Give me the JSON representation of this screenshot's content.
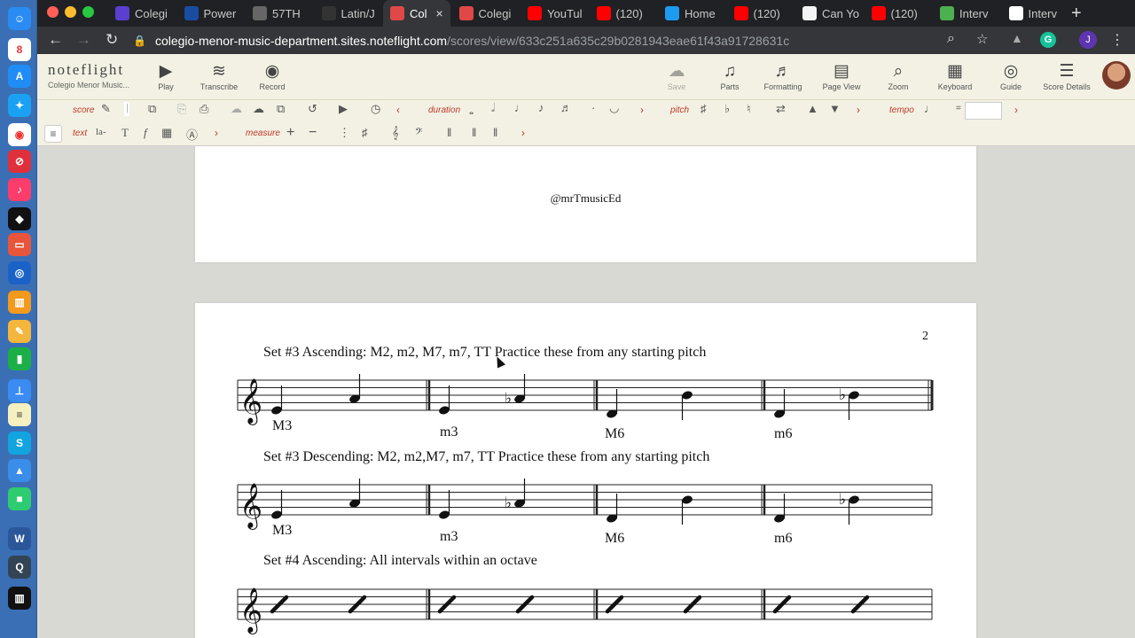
{
  "browser": {
    "tabs": [
      {
        "title": "Colegi",
        "color": "#5b3fd0",
        "icon": "list-icon"
      },
      {
        "title": "Power",
        "color": "#1a4da1",
        "icon": "p-icon"
      },
      {
        "title": "57TH",
        "color": "#666666",
        "icon": "grid-icon"
      },
      {
        "title": "Latin/J",
        "color": "#333333",
        "icon": "s-icon"
      },
      {
        "title": "Col",
        "color": "#e04848",
        "icon": "noteflight-icon"
      },
      {
        "title": "Colegi",
        "color": "#e04848",
        "icon": "noteflight-icon"
      },
      {
        "title": "YouTul",
        "color": "#ff0000",
        "icon": "youtube-icon"
      },
      {
        "title": "(120)",
        "color": "#ff0000",
        "icon": "youtube-icon"
      },
      {
        "title": "Home",
        "color": "#1d9bf0",
        "icon": "twitter-icon"
      },
      {
        "title": "(120)",
        "color": "#ff0000",
        "icon": "youtube-icon"
      },
      {
        "title": "Can Yo",
        "color": "#f4f4f4",
        "icon": "ja-icon"
      },
      {
        "title": "(120)",
        "color": "#ff0000",
        "icon": "youtube-icon"
      },
      {
        "title": "Interv",
        "color": "#4caf50",
        "icon": "leaf-icon"
      },
      {
        "title": "Interv",
        "color": "#ffffff",
        "icon": "page-icon"
      }
    ],
    "active_tab_close": "×",
    "url_domain": "colegio-menor-music-department.sites.noteflight.com",
    "url_path": "/scores/view/633c251a635c29b0281943eae61f43a91728631c",
    "profile_initial": "J",
    "extension_letter": "G"
  },
  "app": {
    "logo": "noteflight",
    "org": "Colegio Menor Music...",
    "toolbar_left": [
      {
        "label": "Play",
        "icon": "▶"
      },
      {
        "label": "Transcribe",
        "icon": "≋"
      },
      {
        "label": "Record",
        "icon": "◉"
      }
    ],
    "toolbar_right": [
      {
        "label": "Save",
        "icon": "☁"
      },
      {
        "label": "Parts",
        "icon": "♫"
      },
      {
        "label": "Formatting",
        "icon": "♬"
      },
      {
        "label": "Page View",
        "icon": "▤"
      },
      {
        "label": "Zoom",
        "icon": "⌕"
      },
      {
        "label": "Keyboard",
        "icon": "▦"
      },
      {
        "label": "Guide",
        "icon": "◎"
      },
      {
        "label": "Score Details",
        "icon": "☰"
      }
    ]
  },
  "ribbon": {
    "score": "score",
    "duration": "duration",
    "pitch": "pitch",
    "tempo": "tempo",
    "tempo_eq": "=",
    "tempo_value": "",
    "text": "text",
    "lyric": "la-",
    "measure": "measure"
  },
  "score": {
    "credit": "@mrTmusicEd",
    "page_number": "2",
    "systems": [
      {
        "title": "Set #3 Ascending: M2, m2, M7, m7, TT Practice these from any starting pitch",
        "labels": [
          "M3",
          "m3",
          "M6",
          "m6"
        ]
      },
      {
        "title": "Set #3 Descending: M2, m2,M7, m7, TT Practice these from any starting pitch",
        "labels": [
          "M3",
          "m3",
          "M6",
          "m6"
        ]
      },
      {
        "title": "Set #4 Ascending: All intervals within an octave",
        "labels": []
      }
    ]
  }
}
